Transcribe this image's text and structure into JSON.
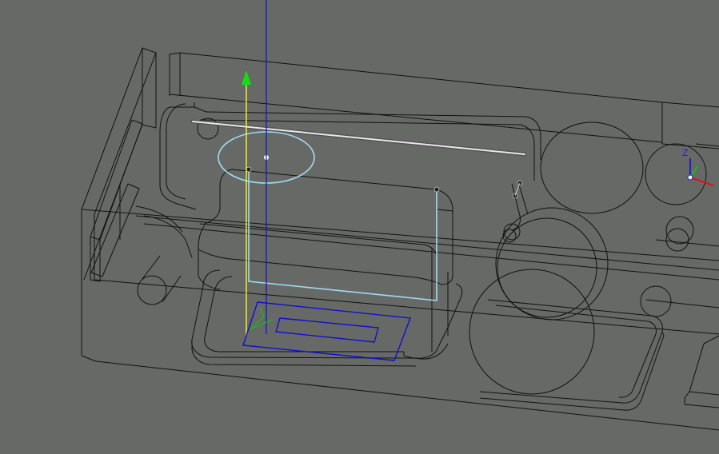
{
  "viewport": {
    "background_color": "#676967",
    "edge_color": "#111111"
  },
  "axes": {
    "z_label": "Z",
    "x_color": "#e01010",
    "y_color": "#10c010",
    "z_color": "#2020d0"
  },
  "selection": {
    "sketch_color": "#1010d0",
    "path_color": "#9fdcf0",
    "highlight_edge_color": "#e8e8e8",
    "vertical_axis_color": "#f0f020",
    "move_arrow_color": "#10e010"
  }
}
